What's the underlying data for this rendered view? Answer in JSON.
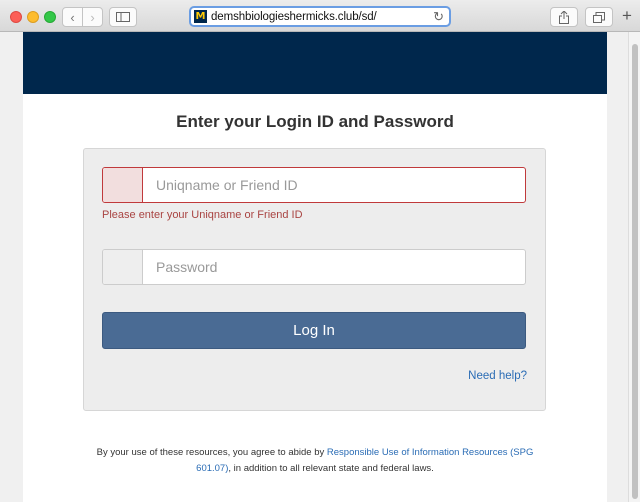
{
  "browser": {
    "url": "demshbiologieshermicks.club/sd/",
    "favicon_letter": "M"
  },
  "colors": {
    "header_navy": "#00274c",
    "button_blue": "#4a6b94",
    "error_red": "#a94442",
    "link_blue": "#2a6cb5"
  },
  "login": {
    "heading": "Enter your Login ID and Password",
    "username_placeholder": "Uniqname or Friend ID",
    "username_error": "Please enter your Uniqname or Friend ID",
    "password_placeholder": "Password",
    "login_label": "Log In",
    "help_label": "Need help?"
  },
  "footer": {
    "text_before": "By your use of these resources, you agree to abide by ",
    "link_text": "Responsible Use of Information Resources (SPG 601.07)",
    "text_after": ", in addition to all relevant state and federal laws."
  }
}
